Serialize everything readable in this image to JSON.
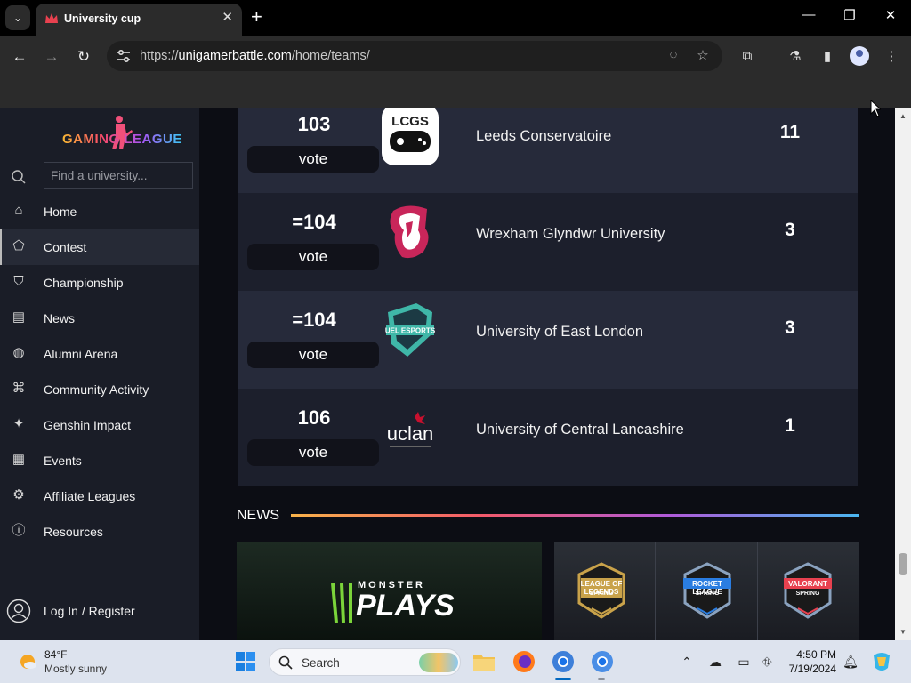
{
  "browser": {
    "tab_title": "University cup",
    "url_prefix": "https://",
    "url_domain": "unigamerbattle.com",
    "url_path": "/home/teams/",
    "new_tab_symbol": "+",
    "close_symbol": "✕"
  },
  "sidebar": {
    "logo_text": "GAMING LEAGUE",
    "search_placeholder": "Find a university...",
    "items": [
      {
        "label": "Home",
        "icon": "home-icon"
      },
      {
        "label": "Contest",
        "icon": "pentagon-icon",
        "active": true
      },
      {
        "label": "Championship",
        "icon": "shield-icon"
      },
      {
        "label": "News",
        "icon": "newspaper-icon"
      },
      {
        "label": "Alumni Arena",
        "icon": "arena-icon"
      },
      {
        "label": "Community Activity",
        "icon": "gift-icon"
      },
      {
        "label": "Genshin Impact",
        "icon": "sparkle-icon"
      },
      {
        "label": "Events",
        "icon": "calendar-icon"
      },
      {
        "label": "Affiliate Leagues",
        "icon": "award-icon"
      },
      {
        "label": "Resources",
        "icon": "info-icon"
      }
    ],
    "login_label": "Log In / Register"
  },
  "teams": [
    {
      "rank": "103",
      "vote_label": "vote",
      "name": "Leeds Conservatoire",
      "score": "11",
      "logo": "lcgs-controller-logo"
    },
    {
      "rank": "=104",
      "vote_label": "vote",
      "name": "Wrexham Glyndwr University",
      "score": "3",
      "logo": "wrexham-lion-logo"
    },
    {
      "rank": "=104",
      "vote_label": "vote",
      "name": "University of East London",
      "score": "3",
      "logo": "uel-esports-logo"
    },
    {
      "rank": "106",
      "vote_label": "vote",
      "name": "University of Central Lancashire",
      "score": "1",
      "logo": "uclan-logo"
    }
  ],
  "team_logo_texts": {
    "lcgs": "LCGS",
    "uel": "UEL ESPORTS",
    "uclan": "uclan"
  },
  "news": {
    "title": "NEWS",
    "card1_small": "MONSTER",
    "card1_big": "PLAYS",
    "badges": [
      {
        "line1": "LEAGUE OF LEGENDS",
        "line2": "SPRING",
        "color": "#c9a24a"
      },
      {
        "line1": "ROCKET LEAGUE",
        "line2": "SPRING",
        "color": "#2a7de1"
      },
      {
        "line1": "VALORANT",
        "line2": "SPRING",
        "color": "#e8414f"
      }
    ]
  },
  "taskbar": {
    "temperature": "84°F",
    "weather": "Mostly sunny",
    "search_label": "Search",
    "time": "4:50 PM",
    "date": "7/19/2024"
  },
  "colors": {
    "accent": "#0067c0",
    "page_bg": "#0f111a",
    "row_light": "#262a3a",
    "row_dark": "#1c1f2c"
  }
}
